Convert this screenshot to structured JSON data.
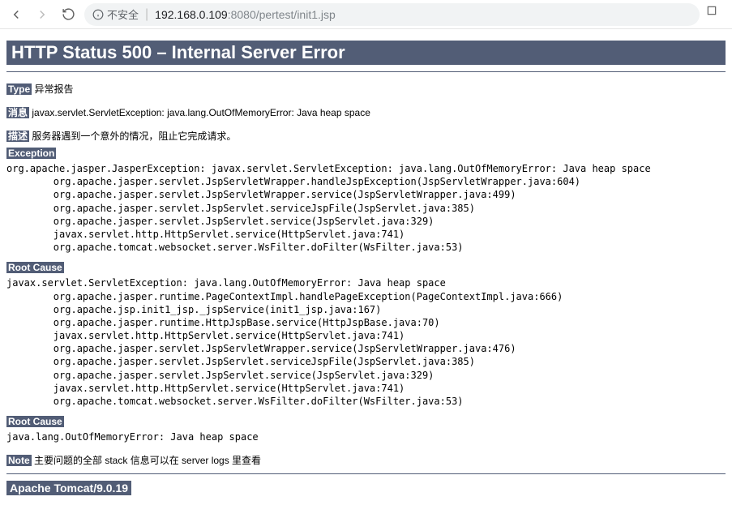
{
  "browser": {
    "security_label": "不安全",
    "url_host": "192.168.0.109",
    "url_port_path": ":8080/pertest/init1.jsp"
  },
  "page": {
    "title": "HTTP Status 500 – Internal Server Error",
    "type_label": "Type",
    "type_value": "异常报告",
    "message_label": "消息",
    "message_value": "javax.servlet.ServletException: java.lang.OutOfMemoryError: Java heap space",
    "description_label": "描述",
    "description_value": "服务器遇到一个意外的情况，阻止它完成请求。",
    "exception_heading": "Exception",
    "exception_trace": "org.apache.jasper.JasperException: javax.servlet.ServletException: java.lang.OutOfMemoryError: Java heap space\n\torg.apache.jasper.servlet.JspServletWrapper.handleJspException(JspServletWrapper.java:604)\n\torg.apache.jasper.servlet.JspServletWrapper.service(JspServletWrapper.java:499)\n\torg.apache.jasper.servlet.JspServlet.serviceJspFile(JspServlet.java:385)\n\torg.apache.jasper.servlet.JspServlet.service(JspServlet.java:329)\n\tjavax.servlet.http.HttpServlet.service(HttpServlet.java:741)\n\torg.apache.tomcat.websocket.server.WsFilter.doFilter(WsFilter.java:53)",
    "root_cause_heading": "Root Cause",
    "root_cause_trace_1": "javax.servlet.ServletException: java.lang.OutOfMemoryError: Java heap space\n\torg.apache.jasper.runtime.PageContextImpl.handlePageException(PageContextImpl.java:666)\n\torg.apache.jsp.init1_jsp._jspService(init1_jsp.java:167)\n\torg.apache.jasper.runtime.HttpJspBase.service(HttpJspBase.java:70)\n\tjavax.servlet.http.HttpServlet.service(HttpServlet.java:741)\n\torg.apache.jasper.servlet.JspServletWrapper.service(JspServletWrapper.java:476)\n\torg.apache.jasper.servlet.JspServlet.serviceJspFile(JspServlet.java:385)\n\torg.apache.jasper.servlet.JspServlet.service(JspServlet.java:329)\n\tjavax.servlet.http.HttpServlet.service(HttpServlet.java:741)\n\torg.apache.tomcat.websocket.server.WsFilter.doFilter(WsFilter.java:53)",
    "root_cause_heading_2": "Root Cause",
    "root_cause_trace_2": "java.lang.OutOfMemoryError: Java heap space",
    "note_label": "Note",
    "note_value": "主要问题的全部 stack 信息可以在 server logs 里查看",
    "server_info": "Apache Tomcat/9.0.19"
  }
}
